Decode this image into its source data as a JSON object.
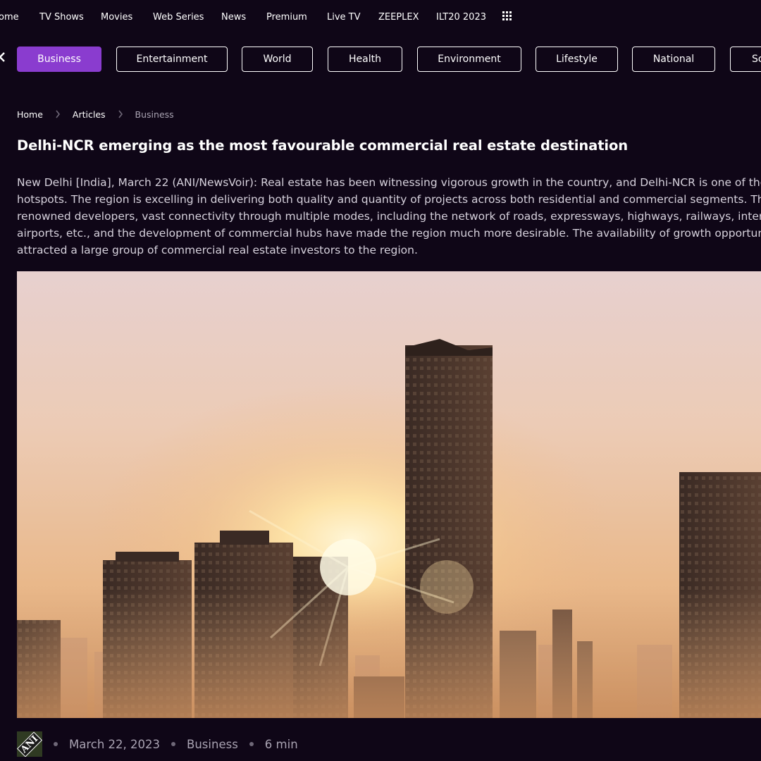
{
  "topnav": {
    "items": [
      "ome",
      "TV Shows",
      "Movies",
      "Web Series",
      "News",
      "Premium",
      "Live TV",
      "ZEEPLEX",
      "ILT20 2023"
    ],
    "grid_icon": "apps-grid-icon"
  },
  "categories": {
    "items": [
      "Business",
      "Entertainment",
      "World",
      "Health",
      "Environment",
      "Lifestyle",
      "National",
      "So"
    ],
    "active": "Business",
    "active_color": "#8a3ccf",
    "back_icon": "chevron-left-icon"
  },
  "breadcrumb": {
    "home": "Home",
    "articles": "Articles",
    "current": "Business"
  },
  "article": {
    "title": "Delhi-NCR emerging as the most favourable commercial real estate destination",
    "body_lines": [
      "New Delhi [India], March 22 (ANI/NewsVoir): Real estate has been witnessing vigorous growth in the country, and Delhi-NCR is one of the most",
      "hotspots. The region is excelling in delivering both quality and quantity of projects across both residential and commercial segments. The avai",
      "renowned developers, vast connectivity through multiple modes, including the network of roads, expressways, highways, railways, internation",
      "airports, etc., and the development of commercial hubs have made the region much more desirable. The availability of growth opportunities h",
      "attracted a large group of commercial real estate investors to the region."
    ],
    "hero_image": "city-skyline-sunset-image"
  },
  "meta": {
    "source_logo": "ANI",
    "date": "March 22, 2023",
    "category": "Business",
    "read_time": "6 min"
  },
  "colors": {
    "background": "#0f0617",
    "accent": "#8a3ccf"
  }
}
